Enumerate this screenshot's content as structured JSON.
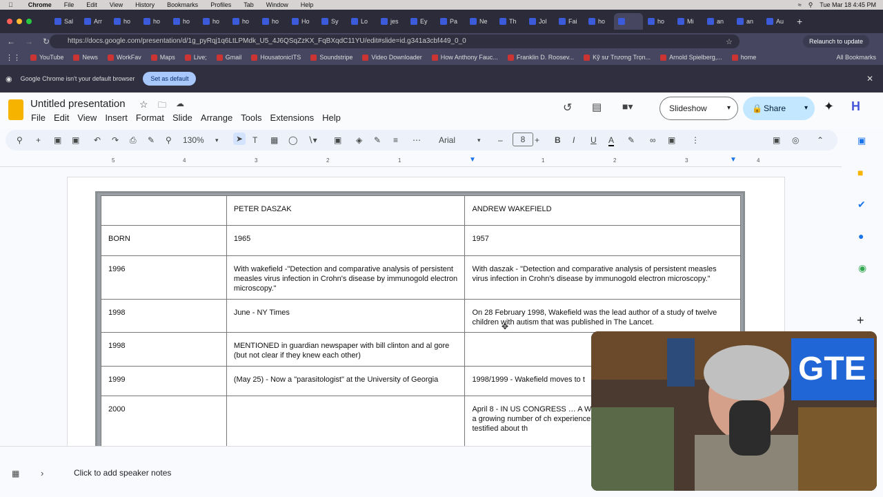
{
  "mac_menubar": {
    "app": "Chrome",
    "items": [
      "File",
      "Edit",
      "View",
      "History",
      "Bookmarks",
      "Profiles",
      "Tab",
      "Window",
      "Help"
    ],
    "clock": "Tue Mar 18  4:45 PM"
  },
  "tabs": [
    "Sal",
    "Arr",
    "ho",
    "ho",
    "ho",
    "ho",
    "ho",
    "ho",
    "Ho",
    "Sy",
    "Lo",
    "jes",
    "Ey",
    "Pa",
    "Ne",
    "Th",
    "Jol",
    "Fai",
    "ho",
    "",
    "ho",
    "Mi",
    "an",
    "an",
    "Au"
  ],
  "active_tab_index": 19,
  "address": {
    "url": "https://docs.google.com/presentation/d/1g_pyRqj1q6LtLPMdk_U5_4J6QSqZzKX_FqBXqdC11YU/edit#slide=id.g341a3cbf449_0_0",
    "relaunch": "Relaunch to update"
  },
  "bookmarks": [
    "YouTube",
    "News",
    "WorkFav",
    "Maps",
    "Live;",
    "Gmail",
    "HousatonicITS",
    "Soundstripe",
    "Video Downloader",
    "How Anthony Fauc...",
    "Franklin D. Roosev...",
    "Kỹ sư Trương Trọn...",
    "Arnold Spielberg,...",
    "home"
  ],
  "all_bookmarks": "All Bookmarks",
  "infobar": {
    "message": "Google Chrome isn't your default browser",
    "button": "Set as default"
  },
  "doc": {
    "title": "Untitled presentation",
    "menu": [
      "File",
      "Edit",
      "View",
      "Insert",
      "Format",
      "Slide",
      "Arrange",
      "Tools",
      "Extensions",
      "Help"
    ],
    "slideshow": "Slideshow",
    "share": "Share"
  },
  "toolbar": {
    "zoom": "130%",
    "font": "Arial",
    "font_size": "8"
  },
  "ruler_labels": [
    "5",
    "4",
    "3",
    "2",
    "1",
    "1",
    "2",
    "3",
    "4"
  ],
  "table": {
    "rows": [
      [
        "",
        "PETER DASZAK",
        "ANDREW WAKEFIELD"
      ],
      [
        "BORN",
        "1965",
        "1957"
      ],
      [
        "1996",
        "With wakefield  -\"Detection and comparative analysis of persistent measles virus infection in Crohn's disease by immunogold electron microscopy.\"",
        "With daszak - \"Detection and comparative analysis of persistent measles virus infection in Crohn's disease by immunogold electron microscopy.\""
      ],
      [
        "1998",
        "June - NY Times",
        "On 28 February 1998, Wakefield was the lead author of a study of twelve children with autism that was published in The Lancet."
      ],
      [
        "1998",
        "MENTIONED in guardian newspaper with bill clinton and al gore (but not clear if they knew each other)",
        ""
      ],
      [
        "1999",
        "(May 25) - Now a \"parasitologist\" at the University of Georgia",
        "1998/1999 - Wakefield moves to t"
      ],
      [
        "2000",
        "",
        "April 8 -  IN US CONGRESS … A Witnesses testified about a theory autism in a growing number of ch experiences with their own autisti researchers then testified about th"
      ]
    ]
  },
  "notes": "Click to add speaker notes"
}
